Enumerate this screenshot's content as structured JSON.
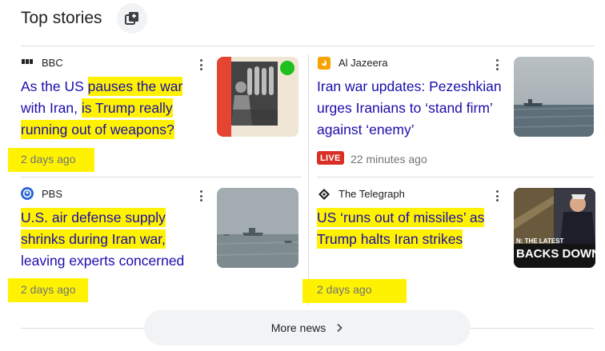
{
  "header": {
    "title": "Top stories",
    "icon": "stacked-cards-icon"
  },
  "stories": [
    {
      "source": "BBC",
      "source_icon": "bbc-logo-icon",
      "title_parts": [
        "As the US ",
        "pauses the war",
        " with Iran, ",
        "is Trump really",
        " running out of weapons?"
      ],
      "time": "2 days ago",
      "thumbnail": "man-with-missile-shells-image"
    },
    {
      "source": "Al Jazeera",
      "source_icon": "al-jazeera-logo-icon",
      "title_parts": [
        "Iran war updates: Pezeshkian urges Iranians to ‘stand firm’ against ‘enemy’"
      ],
      "live_badge": "LIVE",
      "time": "22 minutes ago",
      "thumbnail": "ship-at-sea-image"
    },
    {
      "source": "PBS",
      "source_icon": "pbs-logo-icon",
      "title_parts": [
        "U.S. air defense supply",
        " shrinks during Iran war,",
        " leaving experts concerned"
      ],
      "time": "2 days ago",
      "thumbnail": "ships-in-strait-image"
    },
    {
      "source": "The Telegraph",
      "source_icon": "telegraph-logo-icon",
      "title_parts": [
        "US ‘runs out of missiles’ as",
        " Trump halts Iran strikes"
      ],
      "time": "2 days ago",
      "thumbnail": "trump-saluting-image",
      "thumb_text_1": "N: THE LATEST",
      "thumb_text_2": "BACKS DOWN"
    }
  ],
  "more_news": {
    "label": "More news",
    "icon": "chevron-right-icon"
  },
  "colors": {
    "link": "#1a0dab",
    "highlight": "#fff200",
    "live": "#d93025",
    "muted": "#70757a"
  }
}
